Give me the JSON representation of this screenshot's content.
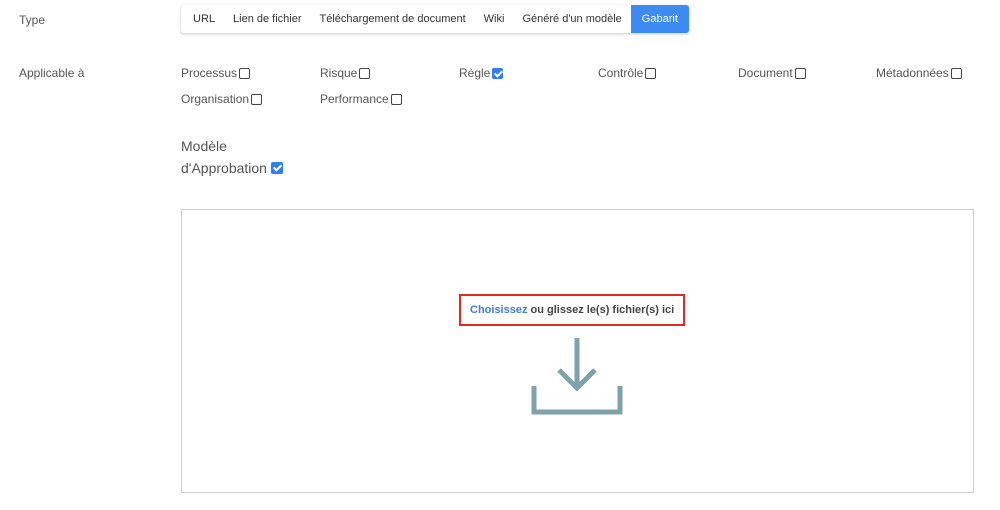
{
  "type_field": {
    "label": "Type",
    "options": [
      "URL",
      "Lien de fichier",
      "Téléchargement de document",
      "Wiki",
      "Généré d'un modèle",
      "Gabarit"
    ],
    "selected": "Gabarit"
  },
  "applicable": {
    "label": "Applicable à",
    "items": [
      {
        "label": "Processus",
        "checked": false
      },
      {
        "label": "Risque",
        "checked": false
      },
      {
        "label": "Règle",
        "checked": true
      },
      {
        "label": "Contrôle",
        "checked": false
      },
      {
        "label": "Document",
        "checked": false
      },
      {
        "label": "Métadonnées",
        "checked": false
      },
      {
        "label": "Organisation",
        "checked": false
      },
      {
        "label": "Performance",
        "checked": false
      }
    ]
  },
  "approval": {
    "line1": "Modèle",
    "line2": "d'Approbation",
    "checked": true
  },
  "dropzone": {
    "choose_link": "Choisissez",
    "rest_text": " ou glissez le(s) fichier(s) ici"
  },
  "colors": {
    "accent": "#3b8bf1",
    "highlight_border": "#e02b20",
    "icon": "#7fa2a8"
  }
}
